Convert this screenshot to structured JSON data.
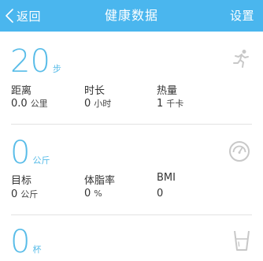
{
  "header": {
    "back_label": "返回",
    "title": "健康数据",
    "settings_label": "设置"
  },
  "steps": {
    "value": "20",
    "unit": "步",
    "metrics": [
      {
        "label": "距离",
        "value": "0.0",
        "unit": "公里"
      },
      {
        "label": "时长",
        "value": "0",
        "unit": "小时"
      },
      {
        "label": "热量",
        "value": "1",
        "unit": "千卡"
      }
    ],
    "icon": "running-person-icon"
  },
  "weight": {
    "value": "0",
    "unit": "公斤",
    "metrics": [
      {
        "label": "目标",
        "value": "0",
        "unit": "公斤"
      },
      {
        "label": "体脂率",
        "value": "0",
        "unit": "%"
      },
      {
        "label": "BMI",
        "value": "0",
        "unit": ""
      }
    ],
    "icon": "scale-gauge-icon"
  },
  "water": {
    "value": "0",
    "unit": "杯",
    "icon": "water-cup-icon"
  },
  "colors": {
    "header_bg": "#4ab6ee",
    "accent": "#58bce8",
    "icon_gray": "#c8c8c8"
  }
}
